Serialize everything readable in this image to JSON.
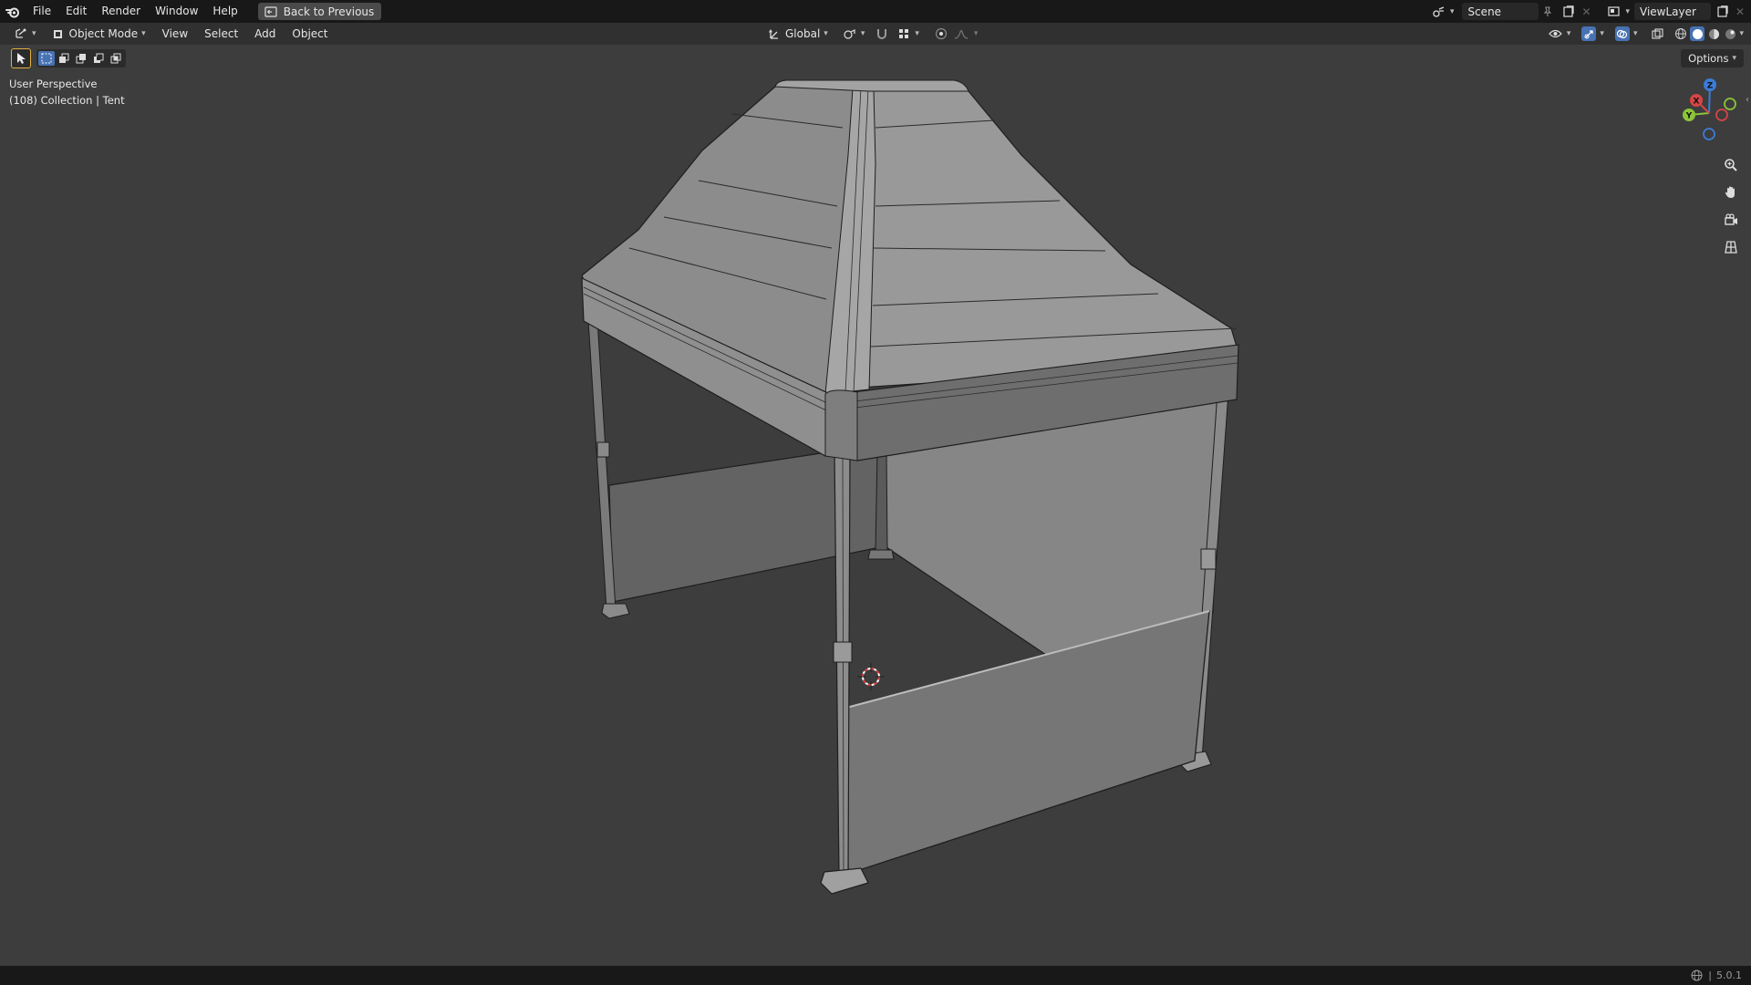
{
  "topbar": {
    "menus": [
      "File",
      "Edit",
      "Render",
      "Window",
      "Help"
    ],
    "back_button": "Back to Previous",
    "scene_name": "Scene",
    "view_layer": "ViewLayer"
  },
  "header": {
    "mode": "Object Mode",
    "menus": [
      "View",
      "Select",
      "Add",
      "Object"
    ],
    "transform_orientation": "Global"
  },
  "viewport": {
    "perspective_label": "User Perspective",
    "collection_label": "(108) Collection | Tent",
    "options_label": "Options",
    "gizmo": {
      "x": "X",
      "y": "Y",
      "z": "Z"
    }
  },
  "status": {
    "version": "5.0.1"
  },
  "colors": {
    "accent": "#4772b3",
    "background": "#3d3d3d",
    "header": "#303030",
    "topbar": "#181818"
  }
}
